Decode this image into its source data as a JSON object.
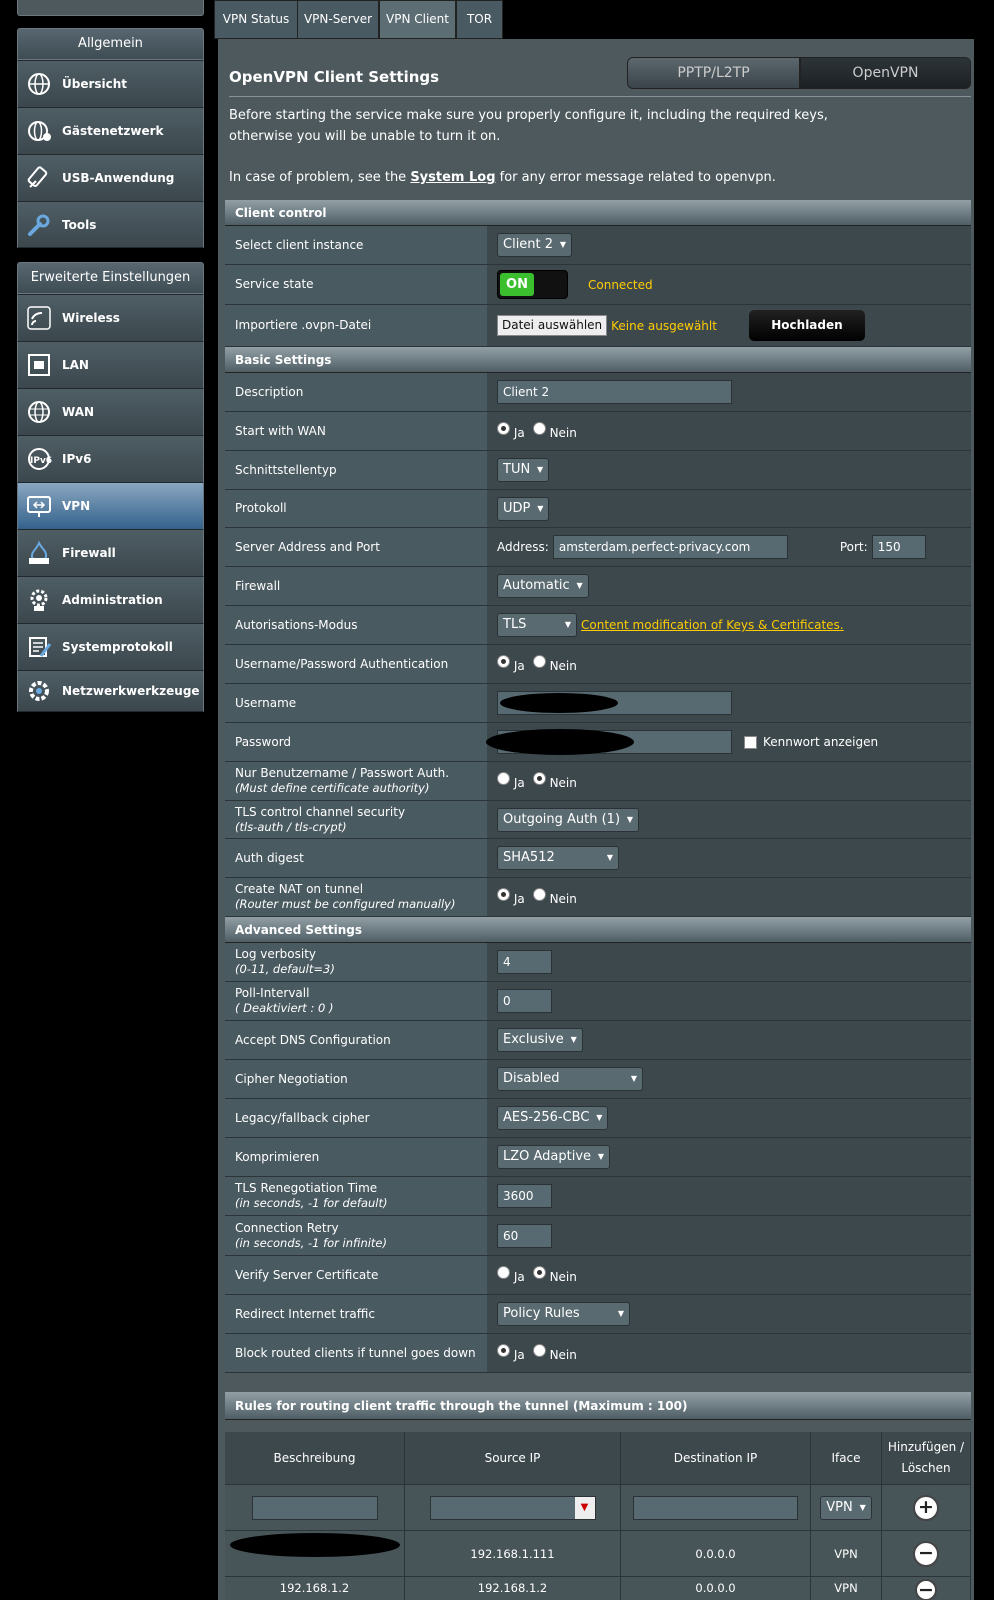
{
  "sidebar": {
    "group1_title": "Allgemein",
    "group1": [
      {
        "label": "Übersicht",
        "icon": "globe-icon"
      },
      {
        "label": "Gästenetzwerk",
        "icon": "guest-network-icon"
      },
      {
        "label": "USB-Anwendung",
        "icon": "usb-icon"
      },
      {
        "label": "Tools",
        "icon": "wrench-icon"
      }
    ],
    "group2_title": "Erweiterte Einstellungen",
    "group2": [
      {
        "label": "Wireless",
        "icon": "wifi-icon"
      },
      {
        "label": "LAN",
        "icon": "lan-icon"
      },
      {
        "label": "WAN",
        "icon": "wan-globe-icon"
      },
      {
        "label": "IPv6",
        "icon": "ipv6-icon"
      },
      {
        "label": "VPN",
        "icon": "vpn-icon",
        "active": true
      },
      {
        "label": "Firewall",
        "icon": "firewall-icon"
      },
      {
        "label": "Administration",
        "icon": "admin-gear-icon"
      },
      {
        "label": "Systemprotokoll",
        "icon": "log-icon"
      },
      {
        "label": "Netzwerkwerkzeuge",
        "icon": "network-tools-icon"
      }
    ]
  },
  "tabs": [
    "VPN Status",
    "VPN-Server",
    "VPN Client",
    "TOR"
  ],
  "page": {
    "title": "OpenVPN Client Settings",
    "seg_left": "PPTP/L2TP",
    "seg_right": "OpenVPN",
    "intro1": "Before starting the service make sure you properly configure it, including the required keys,",
    "intro2": "otherwise you will be unable to turn it on.",
    "intro3_pre": "In case of problem, see the ",
    "intro3_link": "System Log",
    "intro3_post": " for any error message related to openvpn."
  },
  "client_control": {
    "header": "Client control",
    "select_label": "Select client instance",
    "select_value": "Client 2",
    "state_label": "Service state",
    "state_on": "ON",
    "state_status": "Connected",
    "import_label": "Importiere .ovpn-Datei",
    "file_button": "Datei auswählen",
    "file_status": "Keine ausgewählt",
    "upload": "Hochladen"
  },
  "radio": {
    "yes": "Ja",
    "no": "Nein"
  },
  "basic": {
    "header": "Basic Settings",
    "description_label": "Description",
    "description_value": "Client 2",
    "start_wan_label": "Start with WAN",
    "iface_label": "Schnittstellentyp",
    "iface_value": "TUN",
    "proto_label": "Protokoll",
    "proto_value": "UDP",
    "server_label": "Server Address and Port",
    "address_label": "Address:",
    "address_value": "amsterdam.perfect-privacy.com",
    "port_label": "Port:",
    "port_value": "150",
    "firewall_label": "Firewall",
    "firewall_value": "Automatic",
    "auth_mode_label": "Autorisations-Modus",
    "auth_mode_value": "TLS",
    "auth_mode_link": "Content modification of Keys & Certificates.",
    "userpass_label": "Username/Password Authentication",
    "username_label": "Username",
    "password_label": "Password",
    "show_password": "Kennwort anzeigen",
    "user_only_label": "Nur Benutzername / Passwort Auth.",
    "user_only_note": "(Must define certificate authority)",
    "tls_label": "TLS control channel security",
    "tls_note": "(tls-auth / tls-crypt)",
    "tls_value": "Outgoing Auth (1)",
    "digest_label": "Auth digest",
    "digest_value": "SHA512",
    "nat_label": "Create NAT on tunnel",
    "nat_note": "(Router must be configured manually)"
  },
  "advanced": {
    "header": "Advanced Settings",
    "verb_label": "Log verbosity",
    "verb_note": "(0-11, default=3)",
    "verb_value": "4",
    "poll_label": "Poll-Intervall",
    "poll_note": "( Deaktiviert : 0 )",
    "poll_value": "0",
    "dns_label": "Accept DNS Configuration",
    "dns_value": "Exclusive",
    "cipher_neg_label": "Cipher Negotiation",
    "cipher_neg_value": "Disabled",
    "legacy_label": "Legacy/fallback cipher",
    "legacy_value": "AES-256-CBC",
    "comp_label": "Komprimieren",
    "comp_value": "LZO Adaptive",
    "reneg_label": "TLS Renegotiation Time",
    "reneg_note": "(in seconds, -1 for default)",
    "reneg_value": "3600",
    "retry_label": "Connection Retry",
    "retry_note": "(in seconds, -1 for infinite)",
    "retry_value": "60",
    "verify_label": "Verify Server Certificate",
    "redirect_label": "Redirect Internet traffic",
    "redirect_value": "Policy Rules",
    "block_label": "Block routed clients if tunnel goes down"
  },
  "rules": {
    "header": "Rules for routing client traffic through the tunnel (Maximum : 100)",
    "col_desc": "Beschreibung",
    "col_src": "Source IP",
    "col_dst": "Destination IP",
    "col_iface": "Iface",
    "col_action1": "Hinzufügen /",
    "col_action2": "Löschen",
    "new_iface": "VPN",
    "rows": [
      {
        "desc": "",
        "src": "192.168.1.111",
        "dst": "0.0.0.0",
        "iface": "VPN"
      },
      {
        "desc": "192.168.1.2",
        "src": "192.168.1.2",
        "dst": "0.0.0.0",
        "iface": "VPN"
      }
    ]
  }
}
